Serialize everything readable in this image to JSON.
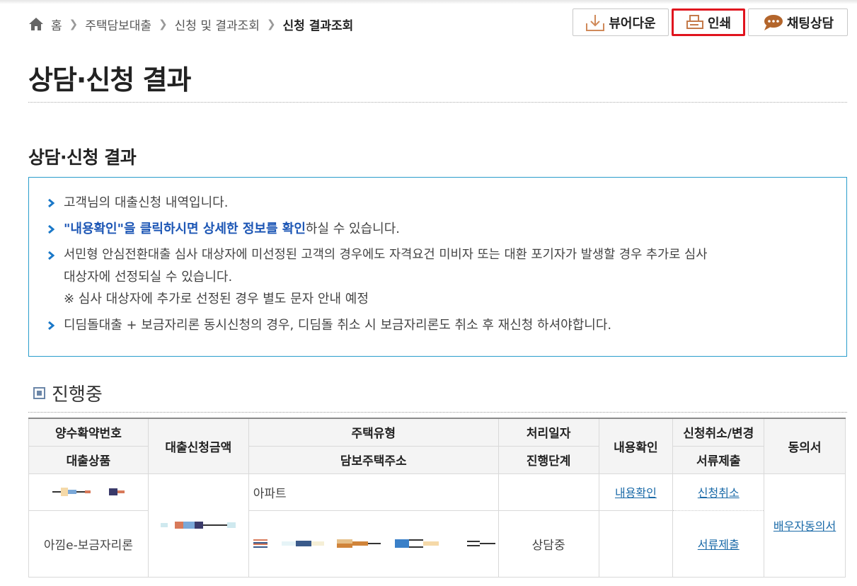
{
  "breadcrumb": {
    "home": "홈",
    "items": [
      "주택담보대출",
      "신청 및 결과조회"
    ],
    "current": "신청 결과조회"
  },
  "actions": {
    "viewer": "뷰어다운",
    "print": "인쇄",
    "chat": "채팅상담"
  },
  "page_title": "상담·신청 결과",
  "section_title": "상담·신청 결과",
  "notice": {
    "line1": "고객님의 대출신청 내역입니다.",
    "line2_highlight": "\"내용확인\"을 클릭하시면 상세한 정보를 확인",
    "line2_rest": "하실 수 있습니다.",
    "line3a": "서민형 안심전환대출 심사 대상자에 미선정된 고객의 경우에도 자격요건 미비자 또는 대환 포기자가 발생할 경우 추가로 심사",
    "line3b": "대상자에 선정되실 수 있습니다.",
    "line3c": "※ 심사 대상자에 추가로 선정된 경우 별도 문자 안내 예정",
    "line4": "디딤돌대출 + 보금자리론 동시신청의 경우, 디딤돌 취소 시 보금자리론도 취소 후 재신청 하셔야합니다."
  },
  "progress_heading": "진행중",
  "table": {
    "headers": {
      "contract_no": "양수확약번호",
      "loan_product": "대출상품",
      "amount": "대출신청금액",
      "house_type": "주택유형",
      "address": "담보주택주소",
      "process_date": "처리일자",
      "stage": "진행단계",
      "check": "내용확인",
      "cancel_change": "신청취소/변경",
      "documents": "서류제출",
      "consent": "동의서"
    },
    "row": {
      "house_type": "아파트",
      "check_link": "내용확인",
      "cancel_link": "신청취소",
      "product": "아낌e-보금자리론",
      "stage": "상담중",
      "docs_link": "서류제출",
      "consent_link": "배우자동의서"
    }
  }
}
